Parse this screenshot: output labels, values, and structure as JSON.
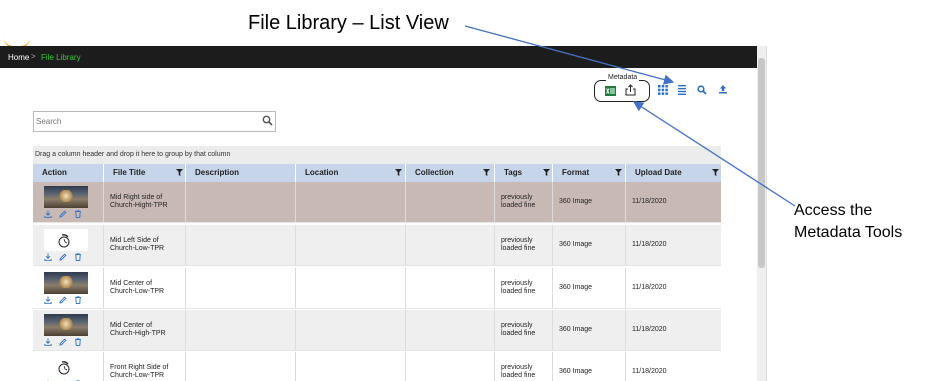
{
  "annotations": {
    "title": "File Library – List View",
    "metadata_callout": [
      "Access the",
      "Metadata Tools"
    ]
  },
  "breadcrumb": {
    "home": "Home",
    "separator": ">",
    "current": "File Library"
  },
  "toolbar": {
    "metadata_label": "Metadata",
    "icons": [
      "excel-icon",
      "export-icon",
      "grid-view-icon",
      "list-view-icon",
      "search-icon",
      "upload-icon"
    ]
  },
  "search": {
    "placeholder": "Search",
    "value": ""
  },
  "grid": {
    "group_hint": "Drag a column header and drop it here to group by that column",
    "columns": [
      "Action",
      "File Title",
      "Description",
      "Location",
      "Collection",
      "Tags",
      "Format",
      "Upload Date"
    ],
    "rows": [
      {
        "title": [
          "Mid Right side of",
          "Church-Hight-TPR"
        ],
        "description": "",
        "location": "",
        "collection": "",
        "tags": [
          "previously",
          "loaded fine"
        ],
        "format": "360 Image",
        "upload_date": "11/18/2020",
        "thumbnail": "panorama",
        "selected": true
      },
      {
        "title": [
          "Mid Left Side of",
          "Church-Low-TPR"
        ],
        "description": "",
        "location": "",
        "collection": "",
        "tags": [
          "previously",
          "loaded fine"
        ],
        "format": "360 Image",
        "upload_date": "11/18/2020",
        "thumbnail": "loading"
      },
      {
        "title": [
          "Mid Center of",
          "Church-Low-TPR"
        ],
        "description": "",
        "location": "",
        "collection": "",
        "tags": [
          "previously",
          "loaded fine"
        ],
        "format": "360 Image",
        "upload_date": "11/18/2020",
        "thumbnail": "panorama"
      },
      {
        "title": [
          "Mid Center of",
          "Church-High-TPR"
        ],
        "description": "",
        "location": "",
        "collection": "",
        "tags": [
          "previously",
          "loaded fine"
        ],
        "format": "360 Image",
        "upload_date": "11/18/2020",
        "thumbnail": "panorama"
      },
      {
        "title": [
          "Front Right Side of",
          "Church-Low-TPR"
        ],
        "description": "",
        "location": "",
        "collection": "",
        "tags": [
          "previously",
          "loaded fine"
        ],
        "format": "360 Image",
        "upload_date": "11/18/2020",
        "thumbnail": "loading"
      }
    ]
  },
  "colors": {
    "navbar": "#1c1c1c",
    "breadcrumb_active": "#37c837",
    "header": "#c6d5ea",
    "selected_row": "#c8b9b5",
    "icon_blue": "#2a6fc9",
    "excel_green": "#1e7b3c",
    "annotation_arrow": "#4472c4"
  }
}
